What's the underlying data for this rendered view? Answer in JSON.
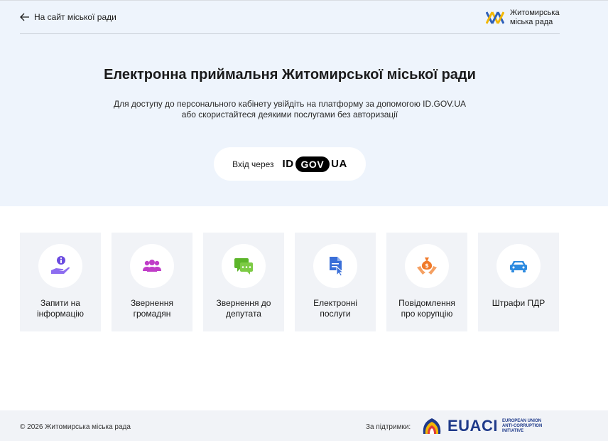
{
  "header": {
    "back_link": "На сайт міської ради",
    "brand_line1": "Житомирська",
    "brand_line2": "міська рада"
  },
  "hero": {
    "title": "Електронна приймальня Житомирської міської ради",
    "subtitle_line1": "Для доступу до персонального кабінету увійдіть на платформу за допомогою ID.GOV.UA",
    "subtitle_line2": "або скористайтеся деякими послугами без авторизації",
    "login_label": "Вхід через",
    "idgov_id": "ID",
    "idgov_gov": "GOV",
    "idgov_ua": "UA"
  },
  "services": [
    {
      "line1": "Запити на",
      "line2": "інформацію",
      "icon": "hand-info-icon",
      "color": "#6b4be0"
    },
    {
      "line1": "Звернення",
      "line2": "громадян",
      "icon": "people-icon",
      "color": "#c03dc8"
    },
    {
      "line1": "Звернення до",
      "line2": "депутата",
      "icon": "chat-icon",
      "color": "#5cb52a"
    },
    {
      "line1": "Електронні",
      "line2": "послуги",
      "icon": "document-cursor-icon",
      "color": "#3a6fd8"
    },
    {
      "line1": "Повідомлення",
      "line2": "про корупцію",
      "icon": "money-bag-hand-icon",
      "color": "#f07a2a"
    },
    {
      "line1": "Штрафи ПДР",
      "line2": "",
      "icon": "car-icon",
      "color": "#2d8be0"
    }
  ],
  "footer": {
    "copyright": "© 2026 Житомирська міська рада",
    "support_label": "За підтримки:",
    "euaci_word": "EUACI",
    "euaci_sub1": "EUROPEAN UNION",
    "euaci_sub2": "ANTI-CORRUPTION",
    "euaci_sub3": "INITIATIVE"
  }
}
